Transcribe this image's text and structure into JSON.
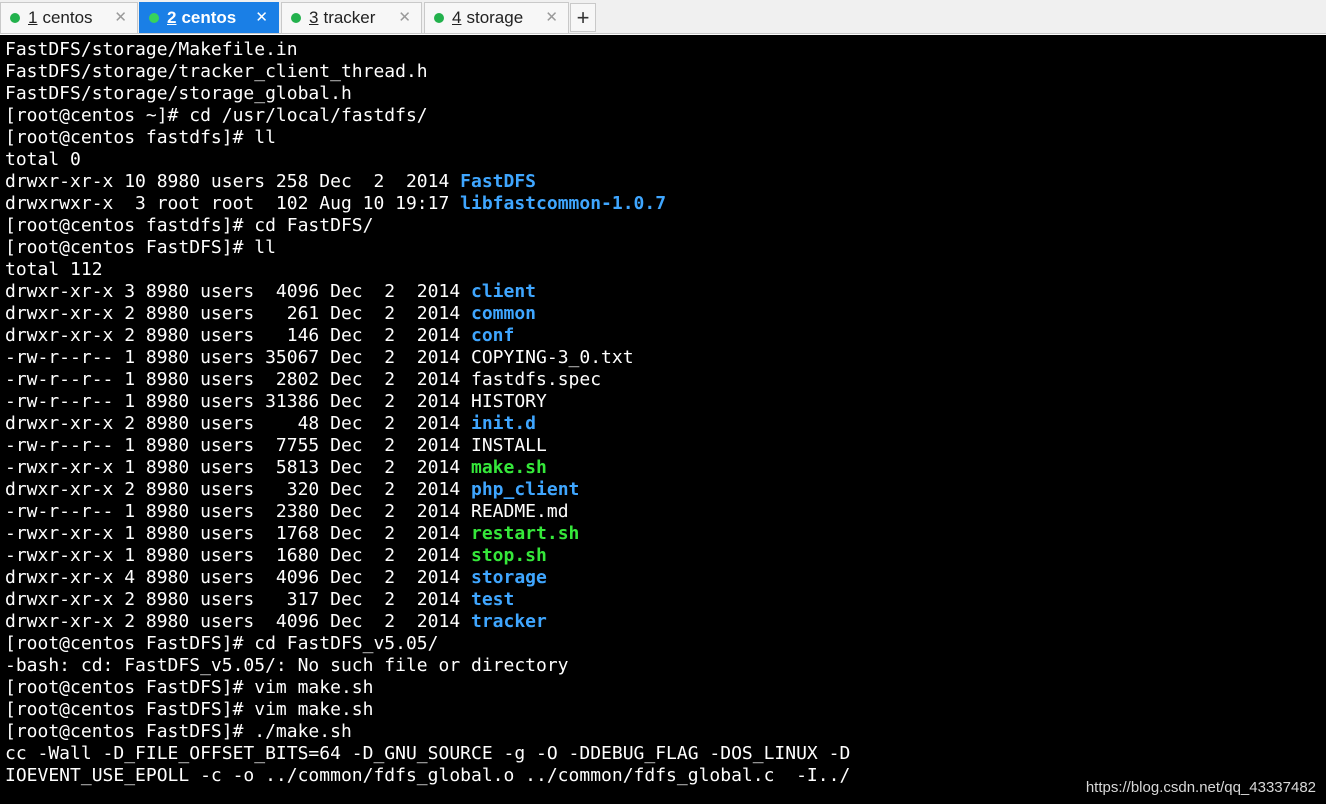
{
  "tabs": [
    {
      "num": "1",
      "label": "centos",
      "active": false
    },
    {
      "num": "2",
      "label": "centos",
      "active": true
    },
    {
      "num": "3",
      "label": "tracker",
      "active": false
    },
    {
      "num": "4",
      "label": "storage",
      "active": false
    }
  ],
  "tab_close_glyph": "✕",
  "new_tab_glyph": "+",
  "colors": {
    "active_tab": "#1a7fe6",
    "status_dot": "#22b14c",
    "terminal_bg": "#000000",
    "directory": "#3fa6ff",
    "executable": "#35e83a"
  },
  "terminal": {
    "lines": [
      {
        "text": "FastDFS/storage/Makefile.in"
      },
      {
        "text": "FastDFS/storage/tracker_client_thread.h"
      },
      {
        "text": "FastDFS/storage/storage_global.h"
      },
      {
        "text": "[root@centos ~]# cd /usr/local/fastdfs/"
      },
      {
        "text": "[root@centos fastdfs]# ll"
      },
      {
        "text": "total 0"
      },
      {
        "text": "drwxr-xr-x 10 8980 users 258 Dec  2  2014 ",
        "name": "FastDFS",
        "type": "dir"
      },
      {
        "text": "drwxrwxr-x  3 root root  102 Aug 10 19:17 ",
        "name": "libfastcommon-1.0.7",
        "type": "dir"
      },
      {
        "text": "[root@centos fastdfs]# cd FastDFS/"
      },
      {
        "text": "[root@centos FastDFS]# ll"
      },
      {
        "text": "total 112"
      },
      {
        "text": "drwxr-xr-x 3 8980 users  4096 Dec  2  2014 ",
        "name": "client",
        "type": "dir"
      },
      {
        "text": "drwxr-xr-x 2 8980 users   261 Dec  2  2014 ",
        "name": "common",
        "type": "dir"
      },
      {
        "text": "drwxr-xr-x 2 8980 users   146 Dec  2  2014 ",
        "name": "conf",
        "type": "dir"
      },
      {
        "text": "-rw-r--r-- 1 8980 users 35067 Dec  2  2014 ",
        "name": "COPYING-3_0.txt",
        "type": "file"
      },
      {
        "text": "-rw-r--r-- 1 8980 users  2802 Dec  2  2014 ",
        "name": "fastdfs.spec",
        "type": "file"
      },
      {
        "text": "-rw-r--r-- 1 8980 users 31386 Dec  2  2014 ",
        "name": "HISTORY",
        "type": "file"
      },
      {
        "text": "drwxr-xr-x 2 8980 users    48 Dec  2  2014 ",
        "name": "init.d",
        "type": "dir"
      },
      {
        "text": "-rw-r--r-- 1 8980 users  7755 Dec  2  2014 ",
        "name": "INSTALL",
        "type": "file"
      },
      {
        "text": "-rwxr-xr-x 1 8980 users  5813 Dec  2  2014 ",
        "name": "make.sh",
        "type": "exe"
      },
      {
        "text": "drwxr-xr-x 2 8980 users   320 Dec  2  2014 ",
        "name": "php_client",
        "type": "dir"
      },
      {
        "text": "-rw-r--r-- 1 8980 users  2380 Dec  2  2014 ",
        "name": "README.md",
        "type": "file"
      },
      {
        "text": "-rwxr-xr-x 1 8980 users  1768 Dec  2  2014 ",
        "name": "restart.sh",
        "type": "exe"
      },
      {
        "text": "-rwxr-xr-x 1 8980 users  1680 Dec  2  2014 ",
        "name": "stop.sh",
        "type": "exe"
      },
      {
        "text": "drwxr-xr-x 4 8980 users  4096 Dec  2  2014 ",
        "name": "storage",
        "type": "dir"
      },
      {
        "text": "drwxr-xr-x 2 8980 users   317 Dec  2  2014 ",
        "name": "test",
        "type": "dir"
      },
      {
        "text": "drwxr-xr-x 2 8980 users  4096 Dec  2  2014 ",
        "name": "tracker",
        "type": "dir"
      },
      {
        "text": "[root@centos FastDFS]# cd FastDFS_v5.05/"
      },
      {
        "text": "-bash: cd: FastDFS_v5.05/: No such file or directory"
      },
      {
        "text": "[root@centos FastDFS]# vim make.sh"
      },
      {
        "text": "[root@centos FastDFS]# vim make.sh"
      },
      {
        "text": "[root@centos FastDFS]# ./make.sh"
      },
      {
        "text": "cc -Wall -D_FILE_OFFSET_BITS=64 -D_GNU_SOURCE -g -O -DDEBUG_FLAG -DOS_LINUX -D"
      },
      {
        "text": "IOEVENT_USE_EPOLL -c -o ../common/fdfs_global.o ../common/fdfs_global.c  -I../"
      }
    ]
  },
  "watermark": "https://blog.csdn.net/qq_43337482"
}
